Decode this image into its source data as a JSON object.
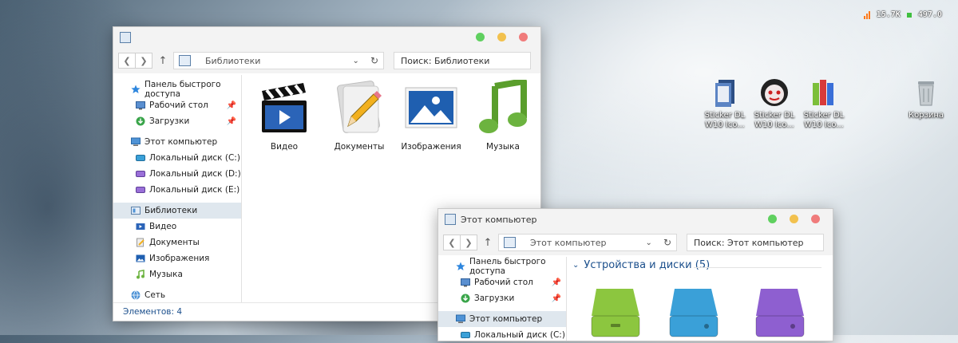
{
  "tray": {
    "up": "15.7K",
    "down": "497.0"
  },
  "desktop": {
    "icons": [
      {
        "label": "Sticker DL W10 Ico...",
        "icon": "folder-stack-icon"
      },
      {
        "label": "Sticker DL W10 Ico...",
        "icon": "vampire-face-icon"
      },
      {
        "label": "Sticker DL W10 Ico...",
        "icon": "books-icon"
      },
      {
        "label": "Корзина",
        "icon": "recycle-bin-icon"
      }
    ]
  },
  "win1": {
    "address": "Библиотеки",
    "search": "Поиск: Библиотеки",
    "sidebar": [
      {
        "label": "Панель быстрого доступа",
        "icon": "star-icon",
        "level": 0
      },
      {
        "label": "Рабочий стол",
        "icon": "desktop-icon",
        "level": 1,
        "pinned": true
      },
      {
        "label": "Загрузки",
        "icon": "download-icon",
        "level": 1,
        "pinned": true
      },
      {
        "label": "Этот компьютер",
        "icon": "computer-icon",
        "level": 0
      },
      {
        "label": "Локальный диск (C:)",
        "icon": "drive-icon",
        "level": 1
      },
      {
        "label": "Локальный диск (D:)",
        "icon": "drive-icon",
        "level": 1
      },
      {
        "label": "Локальный диск (E:)",
        "icon": "drive-icon",
        "level": 1
      },
      {
        "label": "Библиотеки",
        "icon": "library-icon",
        "level": 0,
        "selected": true
      },
      {
        "label": "Видео",
        "icon": "video-icon",
        "level": 1
      },
      {
        "label": "Документы",
        "icon": "document-icon",
        "level": 1
      },
      {
        "label": "Изображения",
        "icon": "image-icon",
        "level": 1
      },
      {
        "label": "Музыка",
        "icon": "music-icon",
        "level": 1
      },
      {
        "label": "Сеть",
        "icon": "network-icon",
        "level": 0
      }
    ],
    "libraries": [
      {
        "label": "Видео",
        "icon": "clapperboard-icon"
      },
      {
        "label": "Документы",
        "icon": "pencil-paper-icon"
      },
      {
        "label": "Изображения",
        "icon": "picture-icon"
      },
      {
        "label": "Музыка",
        "icon": "music-note-icon"
      }
    ],
    "status": "Элементов: 4"
  },
  "win2": {
    "title": "Этот компьютер",
    "address": "Этот компьютер",
    "search": "Поиск: Этот компьютер",
    "sidebar": [
      {
        "label": "Панель быстрого доступа",
        "icon": "star-icon",
        "level": 0
      },
      {
        "label": "Рабочий стол",
        "icon": "desktop-icon",
        "level": 1,
        "pinned": true
      },
      {
        "label": "Загрузки",
        "icon": "download-icon",
        "level": 1,
        "pinned": true
      },
      {
        "label": "Этот компьютер",
        "icon": "computer-icon",
        "level": 0,
        "selected": true
      },
      {
        "label": "Локальный диск (C:)",
        "icon": "drive-icon",
        "level": 1
      }
    ],
    "section_title": "Устройства и диски (5)",
    "drives_colors": [
      "#8cc63f",
      "#3aa0d8",
      "#8e5fd0"
    ]
  },
  "colors": {
    "close": "#f07b7b",
    "minimize": "#f2c14e",
    "maximize": "#5fd05f",
    "accent": "#1b4f8c"
  }
}
